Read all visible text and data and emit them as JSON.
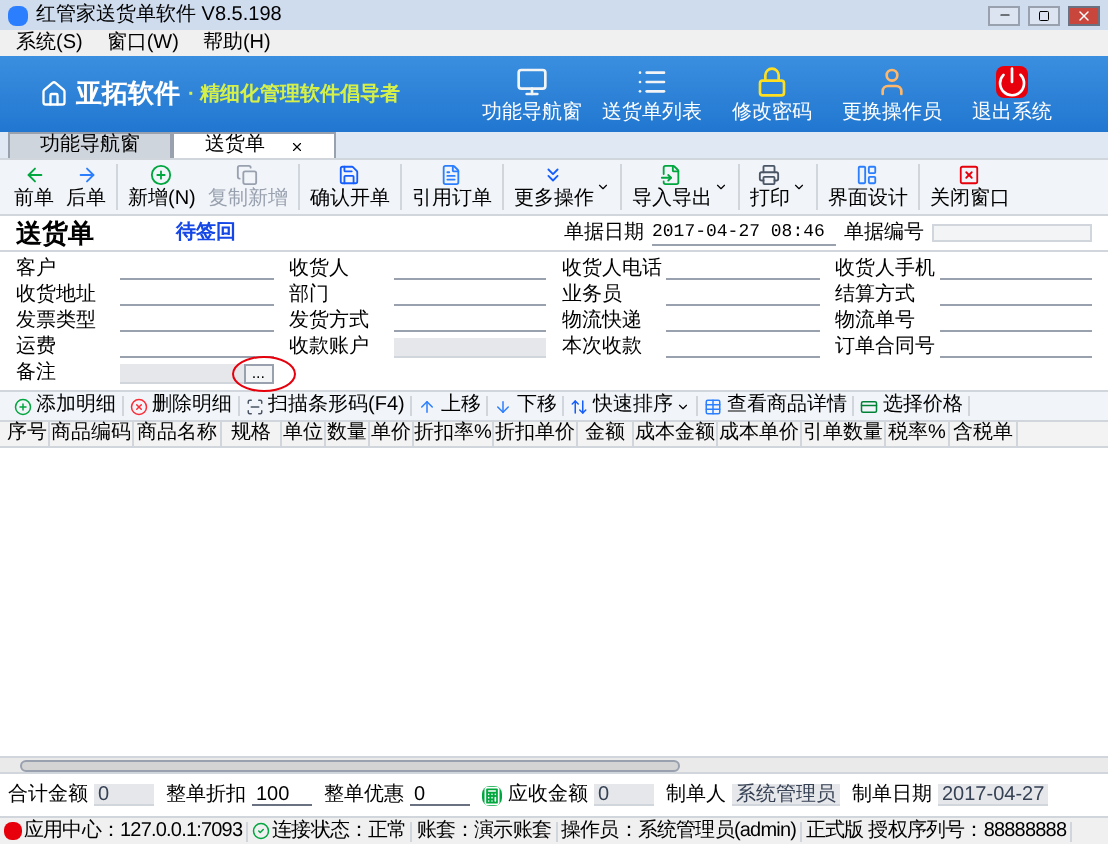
{
  "window": {
    "title": "红管家送货单软件 V8.5.198"
  },
  "menu": [
    "系统(S)",
    "窗口(W)",
    "帮助(H)"
  ],
  "banner": {
    "brand": "亚拓软件",
    "slogan": "· 精细化管理软件倡导者",
    "actions": [
      {
        "label": "功能导航窗",
        "kind": "monitor"
      },
      {
        "label": "送货单列表",
        "kind": "list"
      },
      {
        "label": "修改密码",
        "kind": "lock"
      },
      {
        "label": "更换操作员",
        "kind": "user"
      },
      {
        "label": "退出系统",
        "kind": "power"
      }
    ]
  },
  "tabs": [
    {
      "label": "功能导航窗",
      "selected": false
    },
    {
      "label": "送货单",
      "selected": true
    }
  ],
  "toolbar": [
    {
      "label": "前单",
      "kind": "prev",
      "dropdown": false,
      "disabled": false,
      "sep": false
    },
    {
      "label": "后单",
      "kind": "next",
      "dropdown": false,
      "disabled": false,
      "sep": false
    },
    {
      "label": "新增(N)",
      "kind": "add",
      "dropdown": false,
      "disabled": false,
      "sep": true
    },
    {
      "label": "复制新增",
      "kind": "copy",
      "dropdown": false,
      "disabled": true,
      "sep": false
    },
    {
      "label": "确认开单",
      "kind": "save",
      "dropdown": false,
      "disabled": false,
      "sep": true
    },
    {
      "label": "引用订单",
      "kind": "doc",
      "dropdown": false,
      "disabled": false,
      "sep": true
    },
    {
      "label": "更多操作",
      "kind": "more",
      "dropdown": true,
      "disabled": false,
      "sep": true
    },
    {
      "label": "导入导出",
      "kind": "import",
      "dropdown": true,
      "disabled": false,
      "sep": true
    },
    {
      "label": "打印",
      "kind": "print",
      "dropdown": true,
      "disabled": false,
      "sep": true
    },
    {
      "label": "界面设计",
      "kind": "layout",
      "dropdown": false,
      "disabled": false,
      "sep": true
    },
    {
      "label": "关闭窗口",
      "kind": "close",
      "dropdown": false,
      "disabled": false,
      "sep": true
    }
  ],
  "doc": {
    "title": "送货单",
    "status": "待签回",
    "date_label": "单据日期",
    "date": "2017-04-27 08:46",
    "number_label": "单据编号"
  },
  "fields": [
    {
      "label": "客户",
      "kind": "line"
    },
    {
      "label": "收货人",
      "kind": "line"
    },
    {
      "label": "收货人电话",
      "kind": "line"
    },
    {
      "label": "收货人手机",
      "kind": "line"
    },
    {
      "label": "收货地址",
      "kind": "line"
    },
    {
      "label": "部门",
      "kind": "line"
    },
    {
      "label": "业务员",
      "kind": "line"
    },
    {
      "label": "结算方式",
      "kind": "line"
    },
    {
      "label": "发票类型",
      "kind": "line"
    },
    {
      "label": "发货方式",
      "kind": "line"
    },
    {
      "label": "物流快递",
      "kind": "line"
    },
    {
      "label": "物流单号",
      "kind": "line"
    },
    {
      "label": "运费",
      "kind": "line"
    },
    {
      "label": "收款账户",
      "kind": "readonly"
    },
    {
      "label": "本次收款",
      "kind": "line"
    },
    {
      "label": "订单合同号",
      "kind": "line"
    },
    {
      "label": "备注",
      "kind": "lookup",
      "button": "..."
    }
  ],
  "grid_toolbar": [
    {
      "label": "添加明细",
      "kind": "add",
      "dropdown": false
    },
    {
      "label": "删除明细",
      "kind": "delete",
      "dropdown": false
    },
    {
      "label": "扫描条形码(F4)",
      "kind": "scan",
      "dropdown": false
    },
    {
      "label": "上移",
      "kind": "up",
      "dropdown": false
    },
    {
      "label": "下移",
      "kind": "down",
      "dropdown": false
    },
    {
      "label": "快速排序",
      "kind": "sort",
      "dropdown": true
    },
    {
      "label": "查看商品详情",
      "kind": "detail",
      "dropdown": false
    },
    {
      "label": "选择价格",
      "kind": "price",
      "dropdown": false
    }
  ],
  "table": {
    "columns": [
      "序号",
      "商品编码",
      "商品名称",
      "规格",
      "单位",
      "数量",
      "单价",
      "折扣率%",
      "折扣单价",
      "金额",
      "成本金额",
      "成本单价",
      "引单数量",
      "税率%",
      "含税单"
    ]
  },
  "totals": [
    {
      "label": "合计金额",
      "value": "0",
      "readonly": true,
      "calc_button": false
    },
    {
      "label": "整单折扣",
      "value": "100",
      "readonly": false,
      "calc_button": false
    },
    {
      "label": "整单优惠",
      "value": "0",
      "readonly": false,
      "calc_button": false
    },
    {
      "label": "应收金额",
      "value": "0",
      "readonly": true,
      "calc_button": true
    },
    {
      "label": "制单人",
      "value": "系统管理员",
      "readonly": true,
      "calc_button": false
    },
    {
      "label": "制单日期",
      "value": "2017-04-27",
      "readonly": true,
      "calc_button": false
    }
  ],
  "status_bar": [
    {
      "text": "应用中心：127.0.0.1:7093",
      "kind": "app"
    },
    {
      "text": "连接状态：正常",
      "kind": "ok"
    },
    {
      "text": "账套：演示账套",
      "kind": "plain"
    },
    {
      "text": "操作员：系统管理员(admin)",
      "kind": "plain"
    },
    {
      "text": "正式版 授权序列号：88888888",
      "kind": "plain"
    }
  ]
}
